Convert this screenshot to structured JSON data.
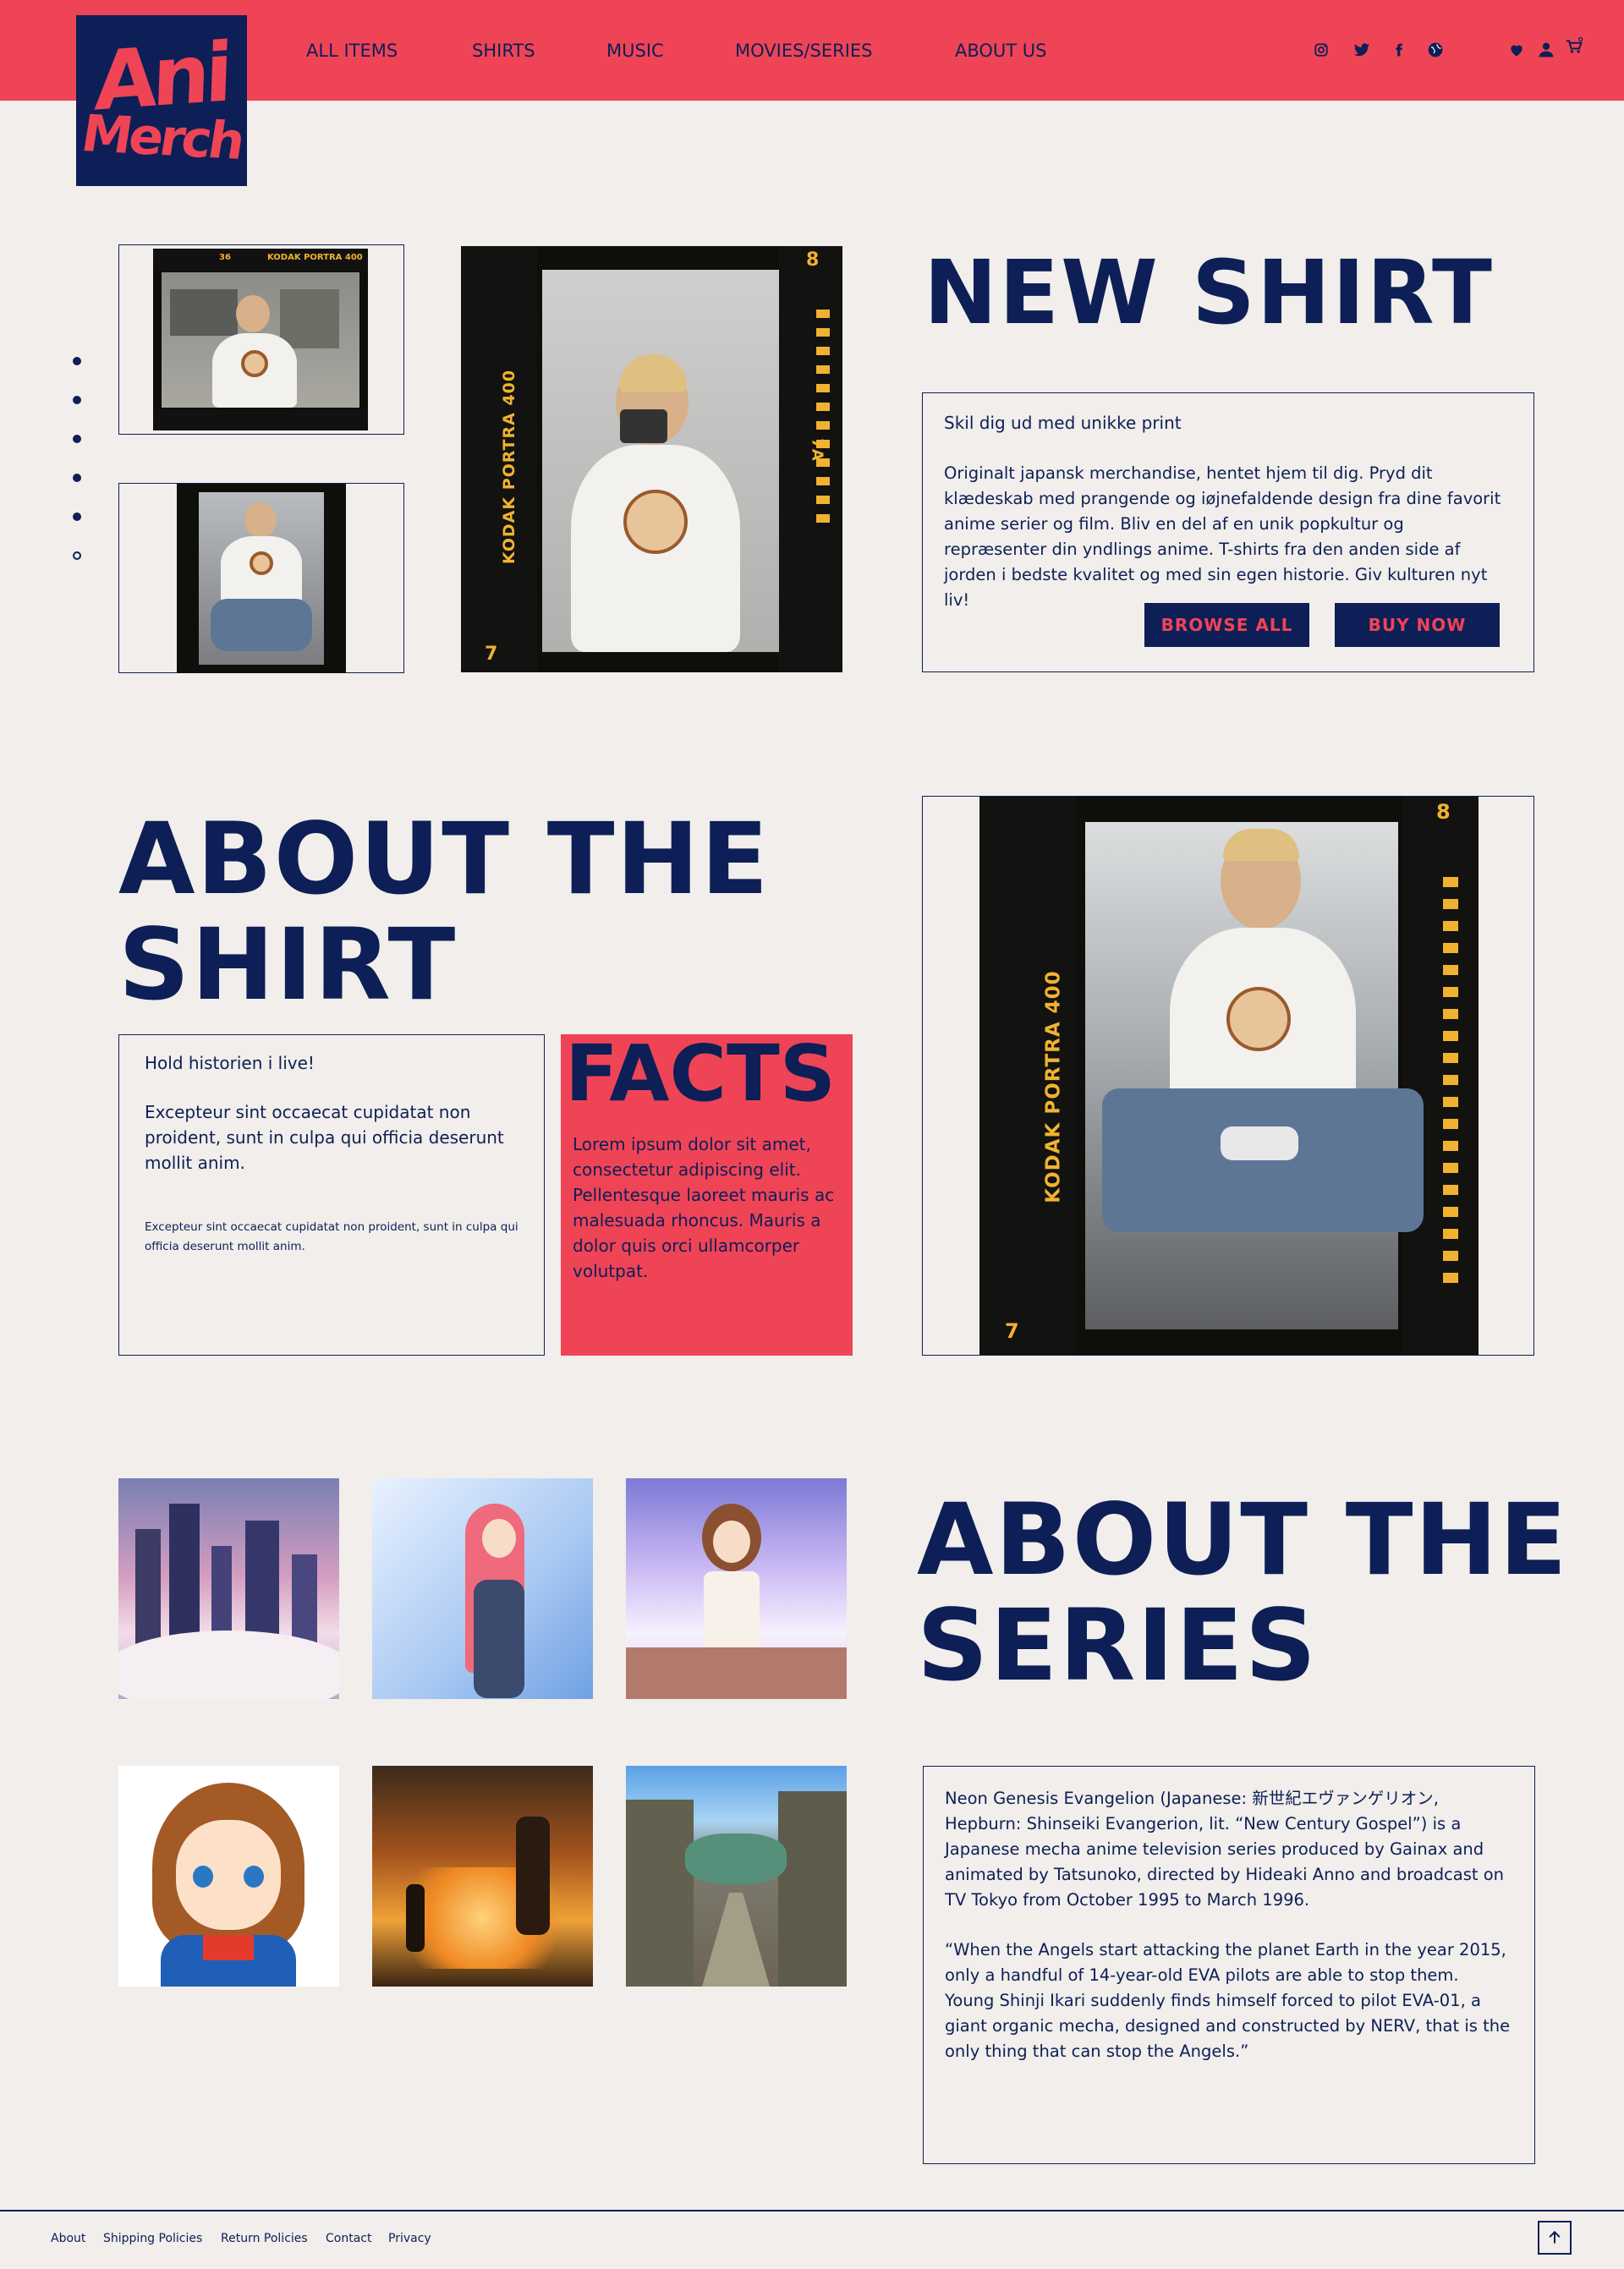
{
  "brand": {
    "logo_line1": "Ani",
    "logo_line2": "Merch"
  },
  "nav": {
    "items": [
      "ALL ITEMS",
      "SHIRTS",
      "MUSIC",
      "MOVIES/SERIES",
      "ABOUT US"
    ]
  },
  "header_icons": [
    "instagram-icon",
    "twitter-icon",
    "facebook-icon",
    "globe-icon",
    "heart-icon",
    "user-icon",
    "cart-icon"
  ],
  "hero": {
    "title": "NEW SHIRT",
    "box_heading": "Skil dig ud med unikke print",
    "box_text": "Originalt japansk merchandise, hentet hjem til dig. Pryd dit klædeskab med prangende og iøjnefaldende design fra dine favorit anime serier og film. Bliv en del af en unik popkultur og repræsenter din yndlings anime. T-shirts fra den anden side af jorden i bedste kvalitet og med sin egen historie. Giv kulturen nyt liv!",
    "browse_label": "BROWSE ALL",
    "buy_label": "BUY NOW",
    "film_label": "KODAK PORTRA 400",
    "film_marks": [
      "8",
      "7",
      "7A",
      "36"
    ]
  },
  "about_shirt": {
    "title_line1": "ABOUT THE",
    "title_line2": "SHIRT",
    "box_heading": "Hold historien i live!",
    "box_text": "Excepteur sint occaecat cupidatat non proident, sunt in culpa qui officia deserunt mollit anim.",
    "box_small": "Excepteur sint occaecat cupidatat non proident, sunt in culpa qui officia deserunt mollit anim.",
    "facts_title": "FACTS",
    "facts_text": "Lorem ipsum dolor sit amet, consectetur adipiscing elit. Pellentesque laoreet mauris ac malesuada rhoncus. Mauris a dolor quis orci ullamcorper volutpat."
  },
  "about_series": {
    "title_line1": "ABOUT THE",
    "title_line2": "SERIES",
    "para1": "Neon Genesis Evangelion (Japanese: 新世紀エヴァンゲリオン, Hepburn: Shinseiki Evangerion, lit. “New Century Gospel”) is a Japanese mecha anime television series produced by Gainax and animated by Tatsunoko, directed by Hideaki Anno and broadcast on TV Tokyo from October 1995 to March 1996.",
    "para2": "“When the Angels start attacking the planet Earth in the year 2015, only a handful of 14-year-old EVA pilots are able to stop them. Young Shinji Ikari suddenly finds himself forced to pilot EVA-01, a giant organic mecha, designed and constructed by NERV, that is the only thing that can stop the Angels.”"
  },
  "footer": {
    "links": [
      "About",
      "Shipping Policies",
      "Return Policies",
      "Contact",
      "Privacy"
    ]
  },
  "colors": {
    "accent": "#ef4456",
    "navy": "#0d1f56",
    "background": "#f1eeeb",
    "film_orange": "#f0b230"
  }
}
